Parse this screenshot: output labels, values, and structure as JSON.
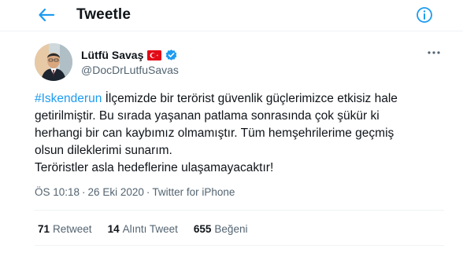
{
  "header": {
    "title": "Tweetle",
    "back_icon": "arrow-left-icon",
    "info_icon": "info-icon"
  },
  "author": {
    "name": "Lütfü Savaş",
    "handle": "@DocDrLutfuSavas",
    "flag_icon": "turkey-flag-icon",
    "verified_icon": "verified-badge-icon"
  },
  "tweet": {
    "hashtag": "#Iskenderun",
    "line1_rest": " İlçemizde bir terörist güvenlik güçlerimizce etkisiz hale",
    "line2": "getirilmiştir. Bu sırada yaşanan patlama sonrasında çok şükür ki",
    "line3": "herhangi bir can kaybımız olmamıştır. Tüm hemşehrilerime geçmiş",
    "line4": "olsun dileklerimi sunarım.",
    "line5": "Teröristler asla hedeflerine ulaşamayacaktır!"
  },
  "meta": {
    "time": "ÖS 10:18",
    "separator": "·",
    "date": "26 Eki 2020",
    "source": "Twitter for iPhone"
  },
  "stats": {
    "retweets": {
      "count": "71",
      "label": "Retweet"
    },
    "quotes": {
      "count": "14",
      "label": "Alıntı Tweet"
    },
    "likes": {
      "count": "655",
      "label": "Beğeni"
    }
  },
  "colors": {
    "accent": "#1d9bf0",
    "text": "#0f1419",
    "muted": "#536471",
    "border": "#eff3f4",
    "flag_red": "#e30a17"
  }
}
